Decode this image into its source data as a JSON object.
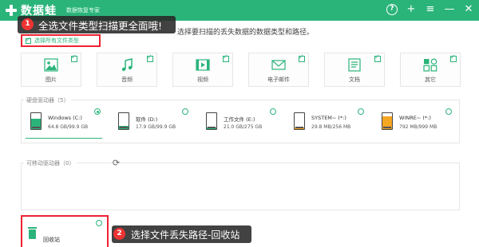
{
  "app": {
    "name": "数据蛙",
    "subtitle": "数据恢复专家"
  },
  "window_controls": [
    {
      "name": "help-icon",
      "glyph": "?"
    },
    {
      "name": "plus-icon",
      "glyph": "+"
    },
    {
      "name": "menu-icon",
      "glyph": "≡"
    },
    {
      "name": "minimize-icon",
      "glyph": "—"
    },
    {
      "name": "close-icon",
      "glyph": "✕"
    }
  ],
  "instruction": "选择要扫描的丢失数据的数据类型和路径。",
  "select_all_label": "选择所有文件类型",
  "file_types": [
    {
      "label": "图片",
      "icon": "image-icon",
      "checked": true
    },
    {
      "label": "音频",
      "icon": "audio-icon",
      "checked": true
    },
    {
      "label": "视频",
      "icon": "video-icon",
      "checked": true
    },
    {
      "label": "电子邮件",
      "icon": "email-icon",
      "checked": true
    },
    {
      "label": "文档",
      "icon": "document-icon",
      "checked": true
    },
    {
      "label": "其它",
      "icon": "other-icon",
      "checked": true
    }
  ],
  "drives_title": "硬盘驱动器（5）",
  "drives": [
    {
      "name": "Windows (C:)",
      "size": "64.8 GB/99.9 GB",
      "used": 0.65,
      "color": "#2bb47a",
      "selected": true
    },
    {
      "name": "软件 (D:)",
      "size": "17.9 GB/99.9 GB",
      "used": 0.18,
      "color": "#2bb47a",
      "selected": false
    },
    {
      "name": "工作文件 (E:)",
      "size": "21.0 GB/275 GB",
      "used": 0.08,
      "color": "#2bb47a",
      "selected": false
    },
    {
      "name": "SYSTEM~ (*:)",
      "size": "29.8 MB/256 MB",
      "used": 0.12,
      "color": "#f5a623",
      "selected": false
    },
    {
      "name": "WINRE~ (*:)",
      "size": "792 MB/999 MB",
      "used": 0.79,
      "color": "#f5a623",
      "selected": false
    }
  ],
  "removable_title": "可移动驱动器（0）",
  "recycle_bin_label": "回收站",
  "callout1": {
    "number": "1",
    "text": "全选文件类型扫描更全面哦!"
  },
  "callout2": {
    "number": "2",
    "text": "选择文件丢失路径-回收站"
  },
  "colors": {
    "accent": "#2bb47a",
    "highlight": "#e23",
    "warning": "#f5a623"
  }
}
